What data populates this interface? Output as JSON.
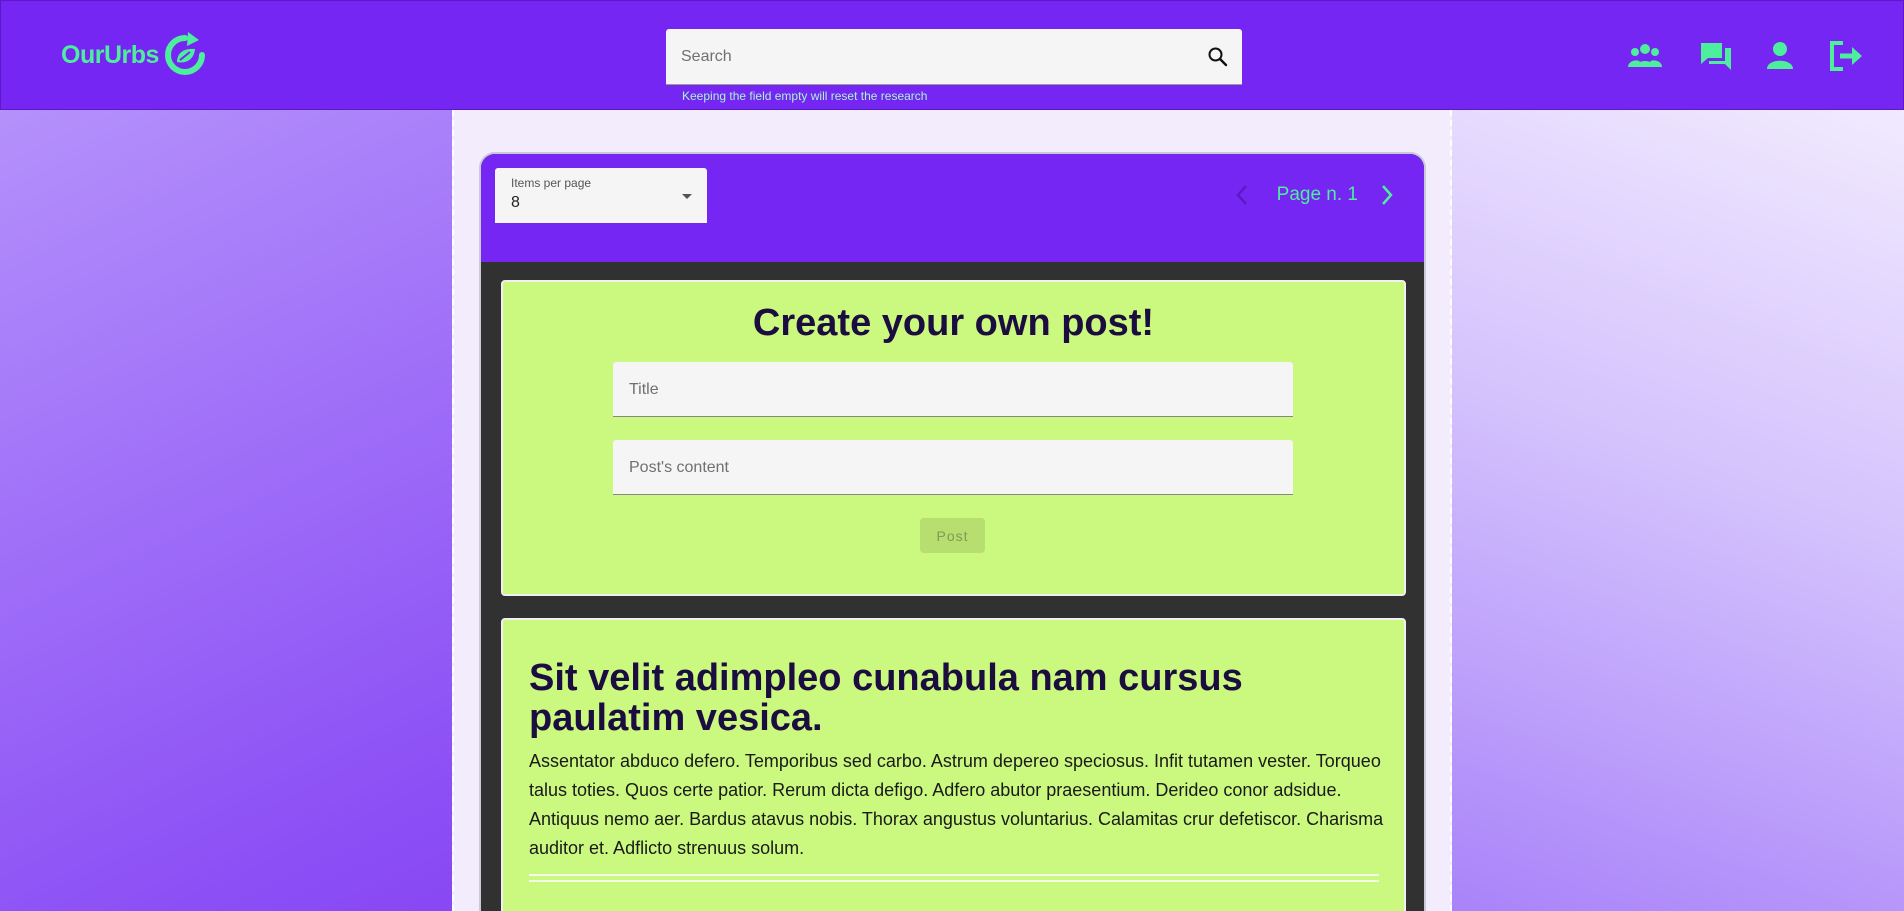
{
  "app": {
    "name": "OurUrbs"
  },
  "search": {
    "placeholder": "Search",
    "hint": "Keeping the field empty will reset the research"
  },
  "nav": {
    "icons": [
      "community-icon",
      "chat-icon",
      "profile-icon",
      "logout-icon"
    ]
  },
  "pagination": {
    "items_per_page_label": "Items per page",
    "items_per_page_value": "8",
    "page_label": "Page n. 1"
  },
  "create_post": {
    "heading": "Create your own post!",
    "title_placeholder": "Title",
    "content_placeholder": "Post's content",
    "post_label": "Post"
  },
  "posts": [
    {
      "title": "Sit velit adimpleo cunabula nam cursus paulatim vesica.",
      "body": "Assentator abduco defero. Temporibus sed carbo. Astrum depereo speciosus. Infit tutamen vester. Torqueo talus toties. Quos certe patior. Rerum dicta defigo. Adfero abutor praesentium. Derideo conor adsidue. Antiquus nemo aer. Bardus atavus nobis. Thorax angustus voluntarius. Calamitas crur defetiscor. Charisma auditor et. Adflicto strenuus solum."
    }
  ],
  "colors": {
    "header": "#7626f2",
    "accent": "#4dee9c",
    "card_bg": "#cbf87e",
    "heading": "#1c0d40"
  }
}
